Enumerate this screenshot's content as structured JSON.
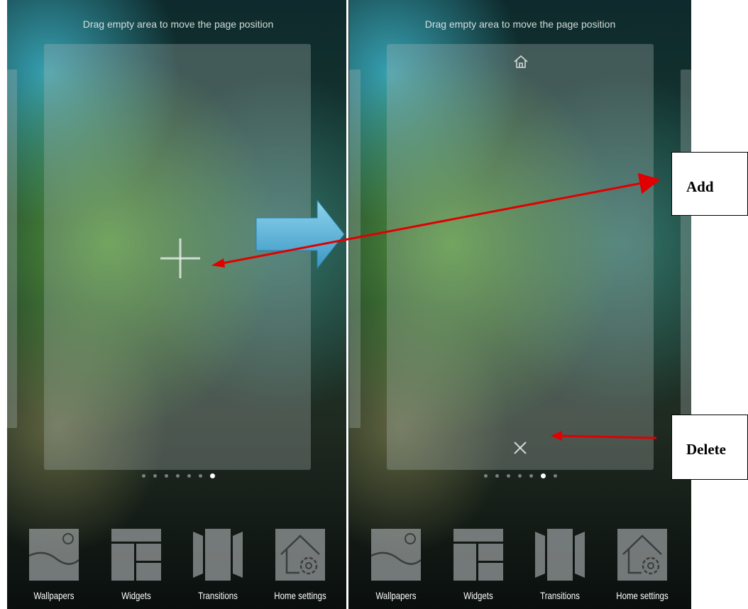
{
  "screens": [
    {
      "hint": "Drag empty area to move the page position",
      "page_indicator": {
        "count": 7,
        "active": 7
      },
      "card_icon": "plus-icon",
      "toolbar": [
        {
          "label": "Wallpapers",
          "icon": "wallpapers-icon"
        },
        {
          "label": "Widgets",
          "icon": "widgets-icon"
        },
        {
          "label": "Transitions",
          "icon": "transitions-icon"
        },
        {
          "label": "Home settings",
          "icon": "home-settings-icon"
        }
      ]
    },
    {
      "hint": "Drag empty area to move the page position",
      "page_indicator": {
        "count": 7,
        "active": 6
      },
      "card_icons": [
        "home-icon",
        "close-icon"
      ],
      "toolbar": [
        {
          "label": "Wallpapers",
          "icon": "wallpapers-icon"
        },
        {
          "label": "Widgets",
          "icon": "widgets-icon"
        },
        {
          "label": "Transitions",
          "icon": "transitions-icon"
        },
        {
          "label": "Home settings",
          "icon": "home-settings-icon"
        }
      ]
    }
  ],
  "annotations": {
    "add_label": "Add",
    "delete_label": "Delete",
    "arrow_color": "#e00000",
    "transition_arrow_color": "#5ab8d8"
  }
}
